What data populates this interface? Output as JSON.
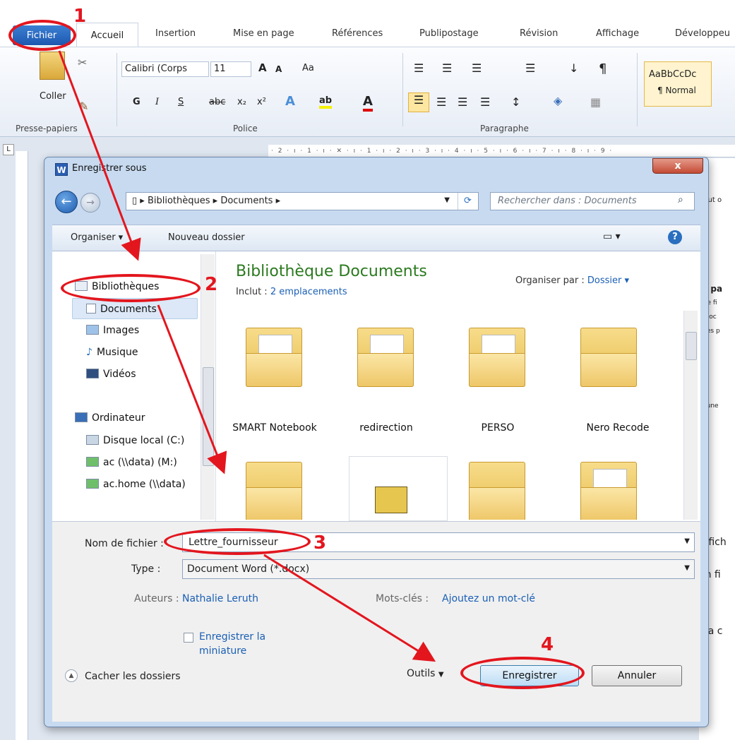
{
  "ribbon": {
    "tabs": [
      "Fichier",
      "Accueil",
      "Insertion",
      "Mise en page",
      "Références",
      "Publipostage",
      "Révision",
      "Affichage",
      "Développeu"
    ],
    "coller": "Coller",
    "font_name": "Calibri (Corps",
    "font_size": "11",
    "bold": "G",
    "italic": "I",
    "underline": "S",
    "group_presse": "Presse-papiers",
    "group_police": "Police",
    "group_paragraphe": "Paragraphe",
    "style_sample": "AaBbCcDc",
    "style_normal": "¶ Normal"
  },
  "document_text": [
    "peut o",
    "le pa",
    "r ce fi",
    "u doc",
    "e les p",
    "ucune",
    "n fich",
    "en fi",
    "y a c"
  ],
  "dialog": {
    "title": "Enregistrer sous",
    "close": "x",
    "address": [
      "Bibliothèques",
      "Documents"
    ],
    "search_placeholder": "Rechercher dans : Documents",
    "toolbar": {
      "organiser": "Organiser",
      "nouveau_dossier": "Nouveau dossier"
    },
    "nav": [
      {
        "label": "Bibliothèques",
        "icon": "library-icon"
      },
      {
        "label": "Documents",
        "icon": "documents-icon"
      },
      {
        "label": "Images",
        "icon": "images-icon"
      },
      {
        "label": "Musique",
        "icon": "music-icon"
      },
      {
        "label": "Vidéos",
        "icon": "video-icon"
      },
      {
        "label": "Ordinateur",
        "icon": "computer-icon"
      },
      {
        "label": "Disque local (C:)",
        "icon": "drive-icon"
      },
      {
        "label": "ac (\\\\data) (M:)",
        "icon": "network-drive-icon"
      },
      {
        "label": "ac.home (\\\\data)",
        "icon": "network-drive-icon"
      }
    ],
    "library_title": "Bibliothèque Documents",
    "inclut_label": "Inclut :",
    "inclut_value": "2 emplacements",
    "organiser_par_label": "Organiser par :",
    "organiser_par_value": "Dossier",
    "folders": [
      "SMART Notebook",
      "redirection",
      "PERSO",
      "Nero Recode"
    ],
    "filename_label": "Nom de fichier :",
    "filename_value": "Lettre_fournisseur",
    "type_label": "Type :",
    "type_value": "Document Word (*.docx)",
    "auteurs_label": "Auteurs :",
    "auteurs_value": "Nathalie Leruth",
    "motscles_label": "Mots-clés :",
    "motscles_value": "Ajoutez un mot-clé",
    "thumbnail_label": "Enregistrer la miniature",
    "hide_folders": "Cacher les dossiers",
    "outils": "Outils",
    "save": "Enregistrer",
    "cancel": "Annuler"
  },
  "annotations": [
    "1",
    "2",
    "3",
    "4"
  ],
  "colors": {
    "annotation": "#e3161e",
    "library_title": "#2b7a1f",
    "link": "#1a5fb4"
  }
}
